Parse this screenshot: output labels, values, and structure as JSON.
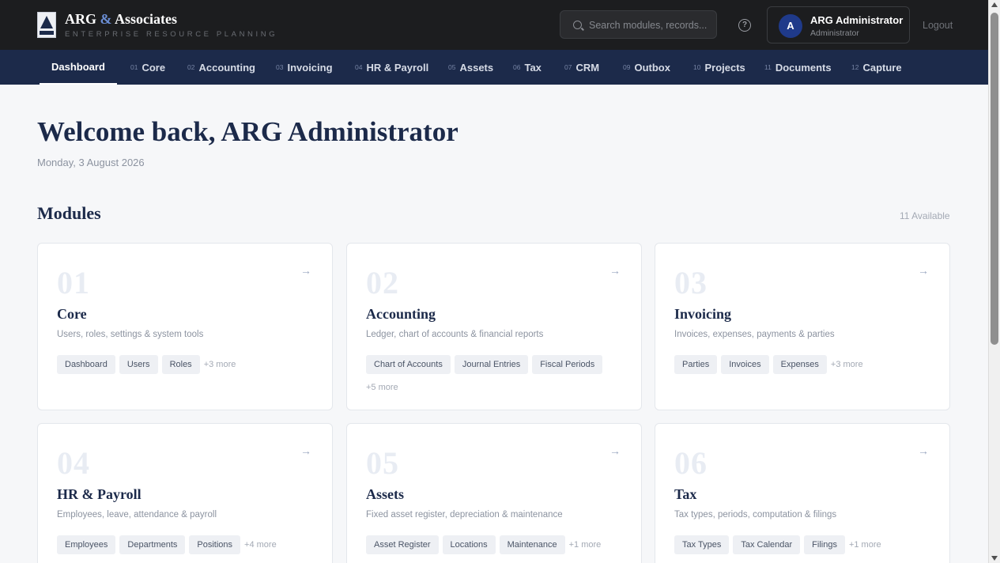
{
  "brand": {
    "name_part1": "ARG",
    "name_amp": "&",
    "name_part2": "Associates",
    "subtitle": "ENTERPRISE RESOURCE PLANNING",
    "accent_color": "#6b8fd6"
  },
  "header": {
    "search_placeholder": "Search modules, records...",
    "help_icon": "help-circle-icon",
    "user": {
      "initial": "A",
      "name": "ARG Administrator",
      "role": "Administrator"
    },
    "logout_label": "Logout"
  },
  "nav": {
    "items": [
      {
        "num": "",
        "label": "Dashboard",
        "active": true
      },
      {
        "num": "01",
        "label": "Core"
      },
      {
        "num": "02",
        "label": "Accounting"
      },
      {
        "num": "03",
        "label": "Invoicing"
      },
      {
        "num": "04",
        "label": "HR & Payroll"
      },
      {
        "num": "05",
        "label": "Assets"
      },
      {
        "num": "06",
        "label": "Tax"
      },
      {
        "num": "07",
        "label": "CRM"
      },
      {
        "num": "09",
        "label": "Outbox"
      },
      {
        "num": "10",
        "label": "Projects"
      },
      {
        "num": "11",
        "label": "Documents"
      },
      {
        "num": "12",
        "label": "Capture"
      }
    ]
  },
  "main": {
    "welcome": "Welcome back, ARG Administrator",
    "date": "Monday, 3 August 2026",
    "modules_title": "Modules",
    "available": "11 Available"
  },
  "modules": [
    {
      "num": "01",
      "title": "Core",
      "desc": "Users, roles, settings & system tools",
      "tags": [
        "Dashboard",
        "Users",
        "Roles"
      ],
      "more": "+3 more"
    },
    {
      "num": "02",
      "title": "Accounting",
      "desc": "Ledger, chart of accounts & financial reports",
      "tags": [
        "Chart of Accounts",
        "Journal Entries",
        "Fiscal Periods"
      ],
      "more": "+5 more"
    },
    {
      "num": "03",
      "title": "Invoicing",
      "desc": "Invoices, expenses, payments & parties",
      "tags": [
        "Parties",
        "Invoices",
        "Expenses"
      ],
      "more": "+3 more"
    },
    {
      "num": "04",
      "title": "HR & Payroll",
      "desc": "Employees, leave, attendance & payroll",
      "tags": [
        "Employees",
        "Departments",
        "Positions"
      ],
      "more": "+4 more"
    },
    {
      "num": "05",
      "title": "Assets",
      "desc": "Fixed asset register, depreciation & maintenance",
      "tags": [
        "Asset Register",
        "Locations",
        "Maintenance"
      ],
      "more": "+1 more"
    },
    {
      "num": "06",
      "title": "Tax",
      "desc": "Tax types, periods, computation & filings",
      "tags": [
        "Tax Types",
        "Tax Calendar",
        "Filings"
      ],
      "more": "+1 more"
    }
  ],
  "card_arrow_icon": "arrow-right-icon"
}
